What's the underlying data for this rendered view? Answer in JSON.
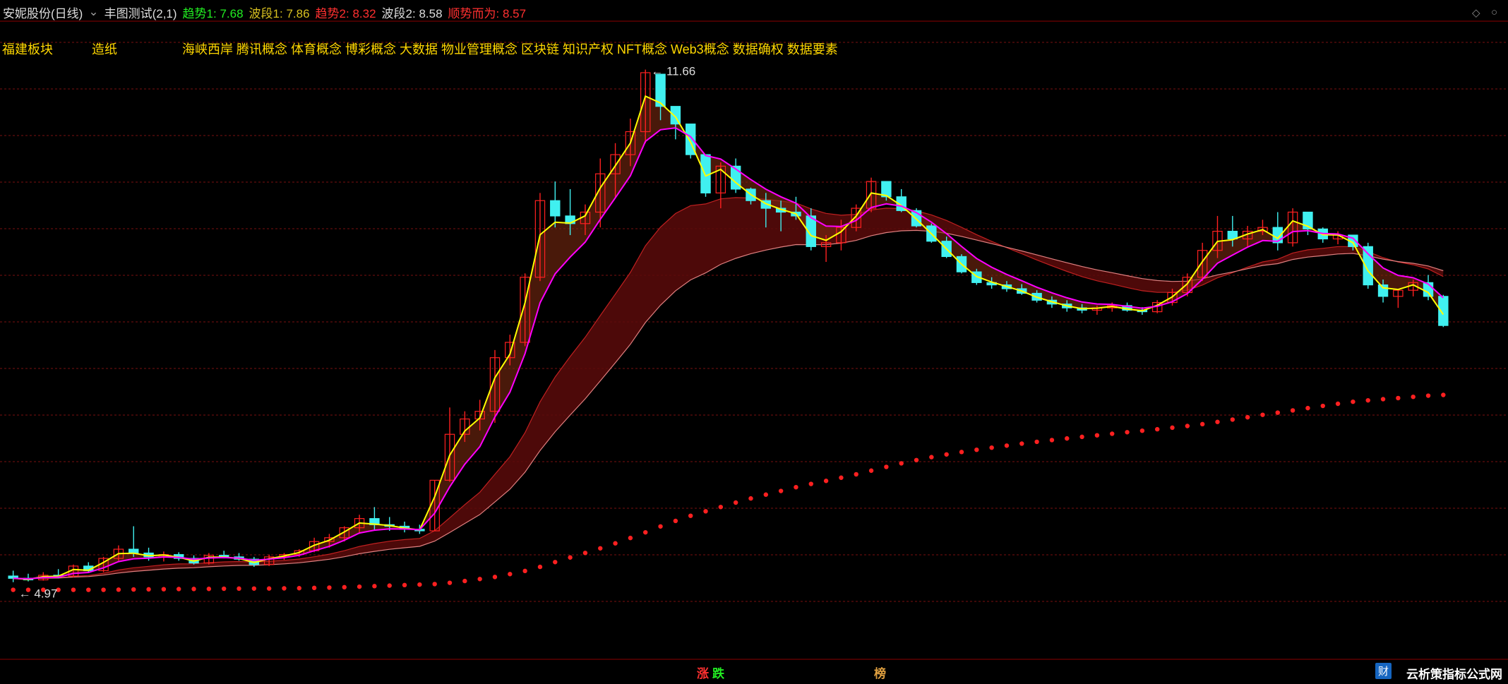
{
  "header": {
    "stock": "安妮股份(日线)",
    "indicator": "丰图测试(2,1)",
    "items": [
      {
        "label": "趋势1: 7.68",
        "color": "#22ee22"
      },
      {
        "label": "波段1: 7.86",
        "color": "#d8c020"
      },
      {
        "label": "趋势2: 8.32",
        "color": "#ff3030"
      },
      {
        "label": "波段2: 8.58",
        "color": "#dddddd"
      },
      {
        "label": "顺势而为: 8.57",
        "color": "#ff3030"
      }
    ]
  },
  "concepts": {
    "region": "福建板块",
    "industry": "造纸",
    "themes": "海峡西岸 腾讯概念 体育概念 博彩概念 大数据 物业管理概念 区块链 知识产权 NFT概念 Web3概念 数据确权 数据要素"
  },
  "bottom_tags": {
    "zhang": "涨",
    "die": "跌",
    "bang": "榜",
    "cai": "财"
  },
  "brand": "云析策指标公式网",
  "icons": [
    "diamond-icon",
    "close-icon",
    "chevron-down-icon"
  ],
  "colors": {
    "up": "#ff2020",
    "down": "#40f0f0",
    "grid": "#7a1010",
    "ma_yellow": "#ffff00",
    "ma_magenta": "#ff00ff"
  },
  "chart_data": {
    "type": "candlestick",
    "y_range": [
      4.0,
      12.2
    ],
    "annotations": {
      "high_label": "11.66",
      "low_label": "4.97"
    },
    "candles": [
      [
        5.05,
        5.12,
        4.97,
        5.02
      ],
      [
        5.02,
        5.08,
        4.98,
        5.0
      ],
      [
        5.0,
        5.1,
        4.99,
        5.06
      ],
      [
        5.06,
        5.14,
        5.02,
        5.05
      ],
      [
        5.05,
        5.2,
        5.03,
        5.18
      ],
      [
        5.18,
        5.23,
        5.1,
        5.12
      ],
      [
        5.12,
        5.3,
        5.1,
        5.28
      ],
      [
        5.28,
        5.45,
        5.25,
        5.4
      ],
      [
        5.4,
        5.7,
        5.3,
        5.35
      ],
      [
        5.35,
        5.42,
        5.25,
        5.3
      ],
      [
        5.3,
        5.37,
        5.24,
        5.33
      ],
      [
        5.33,
        5.36,
        5.25,
        5.28
      ],
      [
        5.28,
        5.32,
        5.2,
        5.22
      ],
      [
        5.22,
        5.35,
        5.2,
        5.32
      ],
      [
        5.32,
        5.38,
        5.28,
        5.3
      ],
      [
        5.3,
        5.35,
        5.25,
        5.27
      ],
      [
        5.27,
        5.3,
        5.17,
        5.2
      ],
      [
        5.2,
        5.33,
        5.18,
        5.3
      ],
      [
        5.3,
        5.35,
        5.26,
        5.33
      ],
      [
        5.33,
        5.4,
        5.3,
        5.38
      ],
      [
        5.38,
        5.55,
        5.36,
        5.5
      ],
      [
        5.5,
        5.6,
        5.42,
        5.55
      ],
      [
        5.55,
        5.7,
        5.5,
        5.68
      ],
      [
        5.68,
        5.85,
        5.6,
        5.8
      ],
      [
        5.8,
        5.95,
        5.65,
        5.72
      ],
      [
        5.72,
        5.82,
        5.64,
        5.7
      ],
      [
        5.7,
        5.76,
        5.62,
        5.66
      ],
      [
        5.66,
        5.72,
        5.6,
        5.64
      ],
      [
        5.64,
        6.3,
        5.64,
        6.3
      ],
      [
        6.3,
        7.25,
        6.28,
        6.9
      ],
      [
        6.9,
        7.2,
        6.8,
        7.1
      ],
      [
        7.1,
        7.35,
        6.95,
        7.2
      ],
      [
        7.2,
        8.0,
        7.05,
        7.9
      ],
      [
        7.9,
        8.2,
        7.8,
        8.1
      ],
      [
        8.1,
        9.0,
        8.05,
        8.95
      ],
      [
        8.95,
        10.05,
        8.9,
        9.95
      ],
      [
        9.95,
        10.2,
        9.6,
        9.75
      ],
      [
        9.75,
        10.1,
        9.5,
        9.65
      ],
      [
        9.65,
        9.9,
        9.5,
        9.8
      ],
      [
        9.8,
        10.5,
        9.6,
        10.3
      ],
      [
        10.3,
        10.7,
        10.0,
        10.55
      ],
      [
        10.55,
        11.02,
        10.4,
        10.85
      ],
      [
        10.85,
        11.66,
        10.7,
        11.62
      ],
      [
        11.6,
        11.2,
        11.0,
        11.18
      ],
      [
        11.18,
        11.1,
        10.75,
        10.95
      ],
      [
        10.95,
        10.6,
        10.5,
        10.55
      ],
      [
        10.55,
        10.5,
        10.0,
        10.05
      ],
      [
        10.05,
        10.45,
        9.85,
        10.4
      ],
      [
        10.4,
        10.5,
        10.05,
        10.1
      ],
      [
        10.1,
        10.12,
        9.9,
        9.95
      ],
      [
        9.95,
        10.05,
        9.6,
        9.85
      ],
      [
        9.85,
        9.95,
        9.55,
        9.8
      ],
      [
        9.8,
        10.0,
        9.7,
        9.75
      ],
      [
        9.75,
        9.85,
        9.3,
        9.35
      ],
      [
        9.35,
        9.5,
        9.15,
        9.4
      ],
      [
        9.4,
        9.7,
        9.3,
        9.6
      ],
      [
        9.6,
        9.9,
        9.55,
        9.85
      ],
      [
        9.85,
        10.25,
        9.8,
        10.2
      ],
      [
        10.2,
        10.12,
        9.95,
        10.0
      ],
      [
        10.0,
        10.1,
        9.8,
        9.82
      ],
      [
        9.82,
        9.85,
        9.6,
        9.62
      ],
      [
        9.62,
        9.65,
        9.4,
        9.42
      ],
      [
        9.42,
        9.48,
        9.2,
        9.22
      ],
      [
        9.22,
        9.25,
        9.0,
        9.02
      ],
      [
        9.02,
        9.06,
        8.85,
        8.88
      ],
      [
        8.88,
        8.95,
        8.8,
        8.85
      ],
      [
        8.85,
        8.9,
        8.76,
        8.8
      ],
      [
        8.8,
        8.86,
        8.72,
        8.74
      ],
      [
        8.74,
        8.78,
        8.62,
        8.65
      ],
      [
        8.65,
        8.7,
        8.55,
        8.6
      ],
      [
        8.6,
        8.65,
        8.5,
        8.55
      ],
      [
        8.55,
        8.6,
        8.48,
        8.52
      ],
      [
        8.52,
        8.58,
        8.46,
        8.55
      ],
      [
        8.55,
        8.62,
        8.5,
        8.58
      ],
      [
        8.58,
        8.62,
        8.5,
        8.52
      ],
      [
        8.52,
        8.56,
        8.46,
        8.5
      ],
      [
        8.5,
        8.65,
        8.48,
        8.62
      ],
      [
        8.62,
        8.8,
        8.58,
        8.75
      ],
      [
        8.75,
        9.0,
        8.7,
        8.95
      ],
      [
        8.95,
        9.4,
        8.9,
        9.3
      ],
      [
        9.3,
        9.75,
        9.2,
        9.55
      ],
      [
        9.55,
        9.75,
        9.35,
        9.45
      ],
      [
        9.45,
        9.62,
        9.35,
        9.55
      ],
      [
        9.55,
        9.7,
        9.5,
        9.6
      ],
      [
        9.6,
        9.8,
        9.3,
        9.4
      ],
      [
        9.4,
        9.85,
        9.35,
        9.8
      ],
      [
        9.8,
        9.65,
        9.5,
        9.58
      ],
      [
        9.58,
        9.6,
        9.4,
        9.45
      ],
      [
        9.45,
        9.55,
        9.38,
        9.5
      ],
      [
        9.5,
        9.48,
        9.3,
        9.35
      ],
      [
        9.35,
        9.4,
        8.8,
        8.85
      ],
      [
        8.85,
        8.92,
        8.62,
        8.7
      ],
      [
        8.7,
        8.8,
        8.55,
        8.78
      ],
      [
        8.78,
        8.92,
        8.7,
        8.88
      ],
      [
        8.88,
        8.98,
        8.65,
        8.7
      ],
      [
        8.7,
        8.72,
        8.3,
        8.32
      ]
    ]
  }
}
